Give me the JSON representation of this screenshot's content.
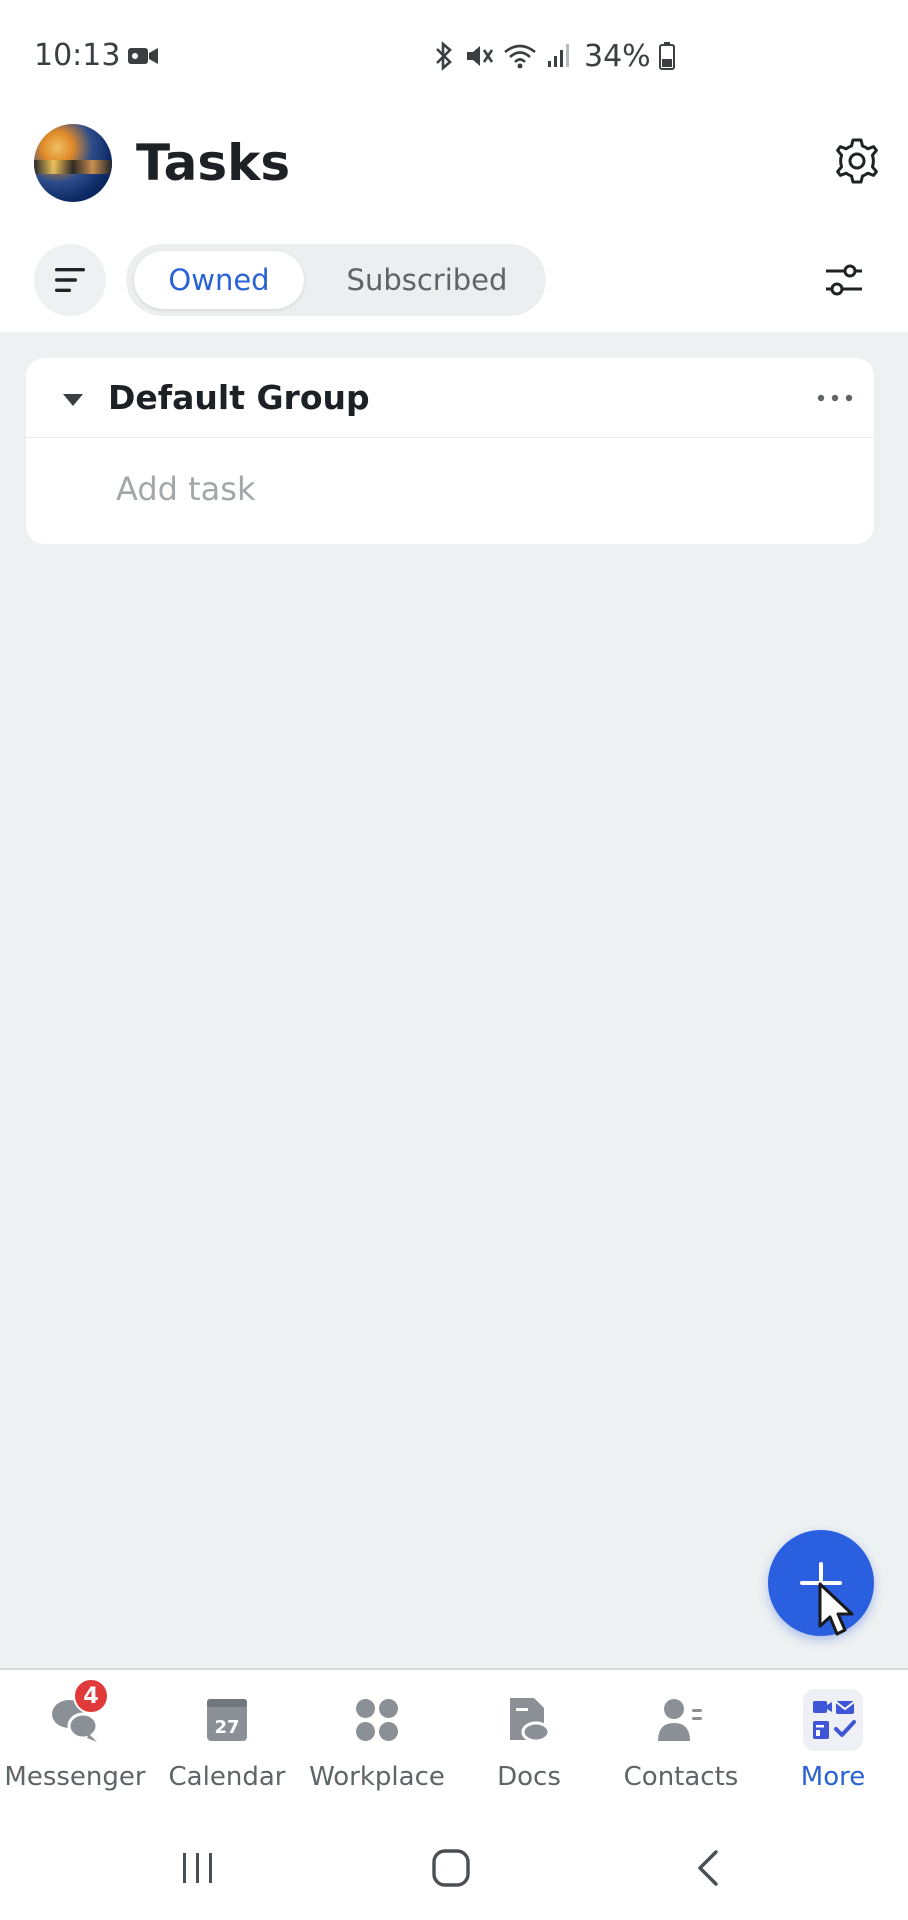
{
  "status_bar": {
    "time": "10:13",
    "battery": "34%",
    "icons": [
      "video-call-icon",
      "bluetooth-icon",
      "mute-icon",
      "wifi-icon",
      "signal-icon",
      "battery-icon"
    ]
  },
  "header": {
    "title": "Tasks",
    "avatar_icon": "avatar",
    "settings_icon": "gear-icon"
  },
  "toolbar": {
    "menu_icon": "menu-icon",
    "tabs": [
      {
        "label": "Owned",
        "selected": true
      },
      {
        "label": "Subscribed",
        "selected": false
      }
    ],
    "filter_icon": "filter-sliders-icon"
  },
  "group": {
    "title": "Default Group",
    "expanded": true,
    "add_task_placeholder": "Add task"
  },
  "fab": {
    "icon": "plus-icon"
  },
  "bottom_nav": {
    "items": [
      {
        "label": "Messenger",
        "icon": "messenger-icon",
        "badge": "4",
        "active": false
      },
      {
        "label": "Calendar",
        "icon": "calendar-icon",
        "calendar_day": "27",
        "active": false
      },
      {
        "label": "Workplace",
        "icon": "workplace-icon",
        "active": false
      },
      {
        "label": "Docs",
        "icon": "docs-icon",
        "active": false
      },
      {
        "label": "Contacts",
        "icon": "contacts-icon",
        "active": false
      },
      {
        "label": "More",
        "icon": "more-apps-icon",
        "active": true
      }
    ]
  },
  "colors": {
    "accent": "#2a63d4",
    "fab": "#2a5fe0",
    "badge": "#e03a3a",
    "background": "#eef1f2",
    "inactive_text": "#5f6467"
  }
}
